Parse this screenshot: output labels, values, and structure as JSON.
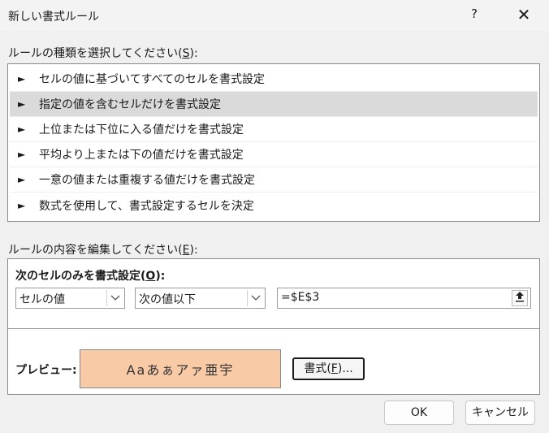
{
  "window": {
    "title": "新しい書式ルール",
    "help_label": "?",
    "close_label": "✕"
  },
  "rule_type": {
    "label_prefix": "ルールの種類を選択してください(",
    "label_key": "S",
    "label_suffix": "):",
    "items": [
      {
        "label": "セルの値に基づいてすべてのセルを書式設定",
        "selected": false
      },
      {
        "label": "指定の値を含むセルだけを書式設定",
        "selected": true
      },
      {
        "label": "上位または下位に入る値だけを書式設定",
        "selected": false
      },
      {
        "label": "平均より上または下の値だけを書式設定",
        "selected": false
      },
      {
        "label": "一意の値または重複する値だけを書式設定",
        "selected": false
      },
      {
        "label": "数式を使用して、書式設定するセルを決定",
        "selected": false
      }
    ]
  },
  "rule_edit": {
    "label_prefix": "ルールの内容を編集してください(",
    "label_key": "E",
    "label_suffix": "):",
    "format_only_prefix": "次のセルのみを書式設定(",
    "format_only_key": "O",
    "format_only_suffix": "):",
    "condition_type": "セルの値",
    "operator": "次の値以下",
    "reference_value": "=$E$3",
    "preview_label": "プレビュー:",
    "preview_text": "Aaあぁアァ亜宇",
    "preview_color": "#f8caa6",
    "format_button_prefix": "書式(",
    "format_button_key": "F",
    "format_button_suffix": ")..."
  },
  "buttons": {
    "ok": "OK",
    "cancel": "キャンセル"
  }
}
